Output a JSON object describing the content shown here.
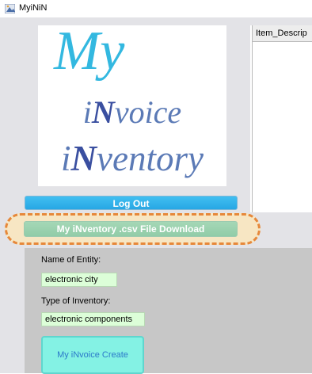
{
  "window": {
    "title": "MyiNiN",
    "icon": "java-app-icon"
  },
  "logo": {
    "line1": "My",
    "line2_prefix": "i",
    "line2_bold": "N",
    "line2_rest": "voice",
    "line3_prefix": "i",
    "line3_bold": "N",
    "line3_rest": "ventory"
  },
  "table": {
    "columns": [
      "Item_Descrip"
    ]
  },
  "buttons": {
    "logout": "Log Out",
    "csv_download": "My iNventory .csv File Download",
    "create": "My iNvoice Create"
  },
  "form": {
    "entity_label": "Name of Entity:",
    "entity_value": "electronic city",
    "inventory_type_label": "Type of Inventory:",
    "inventory_type_value": "electronic components"
  },
  "colors": {
    "accent_blue": "#33b8e0",
    "logout_button": "#27a7e4",
    "download_button": "#91cca8",
    "highlight_dash": "#e6883a",
    "create_button": "#84f2e4",
    "field_bg": "#dcfed8"
  }
}
